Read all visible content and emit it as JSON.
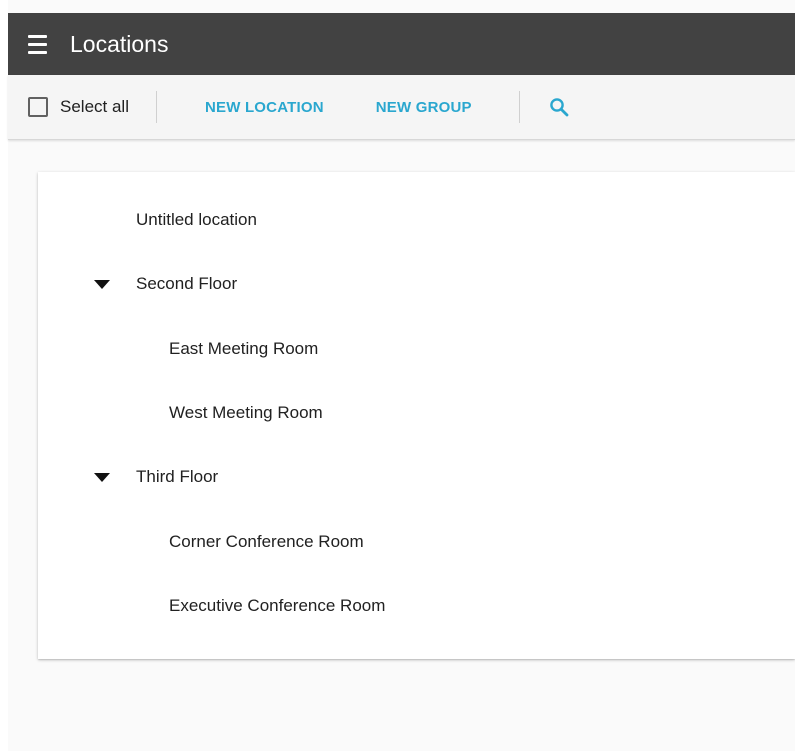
{
  "app": {
    "title": "Locations"
  },
  "toolbar": {
    "select_all_label": "Select all",
    "new_location_label": "NEW LOCATION",
    "new_group_label": "NEW GROUP",
    "accent_color": "#2aa7cf"
  },
  "icons": {
    "menu": "hamburger-menu-icon",
    "search": "search-icon",
    "expanded": "caret-down-icon"
  },
  "tree": {
    "items": [
      {
        "label": "Untitled location",
        "level": 0,
        "expandable": false
      },
      {
        "label": "Second Floor",
        "level": 0,
        "expandable": true,
        "expanded": true
      },
      {
        "label": "East Meeting Room",
        "level": 1,
        "expandable": false
      },
      {
        "label": "West Meeting Room",
        "level": 1,
        "expandable": false
      },
      {
        "label": "Third Floor",
        "level": 0,
        "expandable": true,
        "expanded": true
      },
      {
        "label": "Corner Conference Room",
        "level": 1,
        "expandable": false
      },
      {
        "label": "Executive Conference Room",
        "level": 1,
        "expandable": false
      }
    ]
  }
}
